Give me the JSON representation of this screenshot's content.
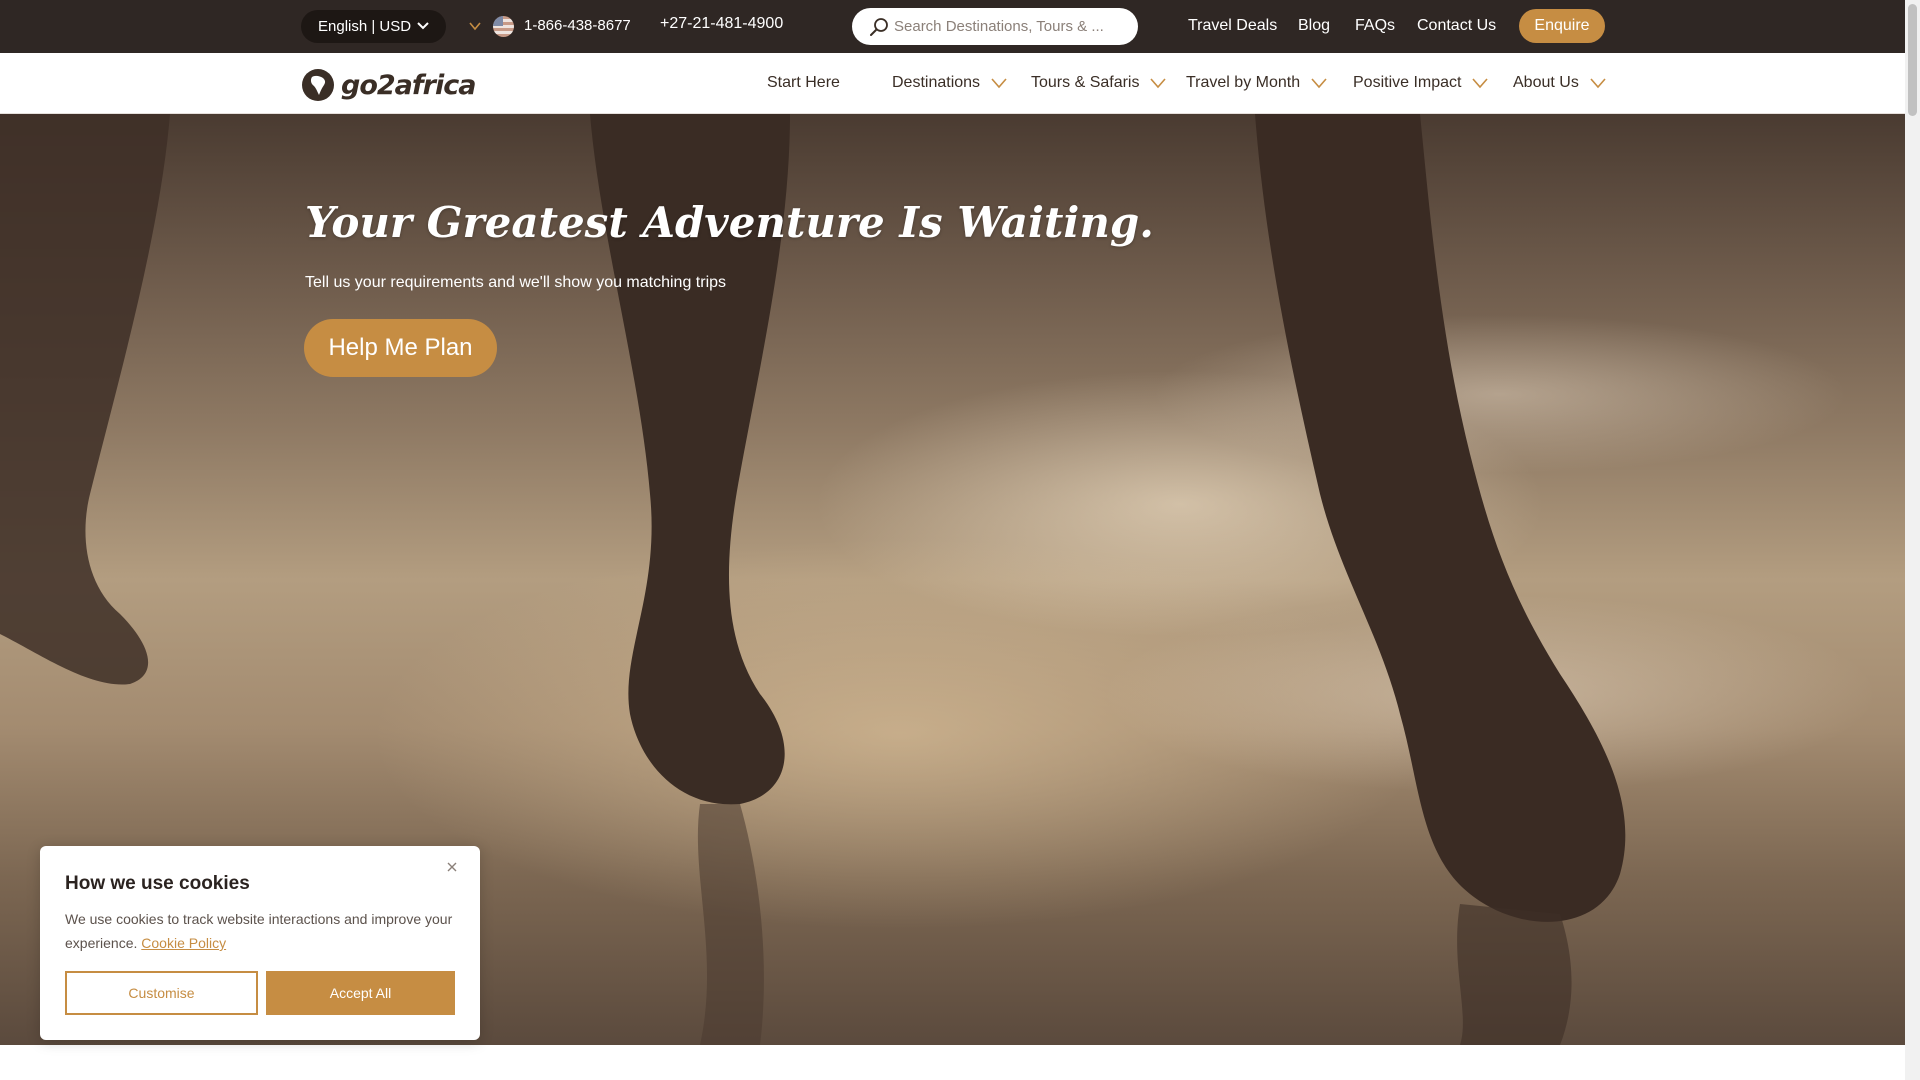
{
  "topbar": {
    "language_currency": "English | USD",
    "phone_primary": "1-866-438-8677",
    "phone_secondary": "+27-21-481-4900",
    "search_placeholder": "Search Destinations, Tours & ...",
    "links": [
      "Travel Deals",
      "Blog",
      "FAQs",
      "Contact Us"
    ],
    "enquire_label": "Enquire",
    "flag_icon": "us-flag-icon"
  },
  "nav": {
    "logo_text": "go2africa",
    "items": [
      "Start Here",
      "Destinations",
      "Tours & Safaris",
      "Travel by Month",
      "Positive Impact",
      "About Us"
    ]
  },
  "hero": {
    "title": "Your Greatest Adventure Is Waiting.",
    "subtitle": "Tell us your requirements and we'll show you matching trips",
    "cta_label": "Help Me Plan"
  },
  "cookie": {
    "title": "How we use cookies",
    "text": "We use cookies to track website interactions and improve your experience.",
    "policy_link": "Cookie Policy",
    "customise_label": "Customise",
    "accept_label": "Accept All"
  },
  "colors": {
    "accent": "#c68d43",
    "topbar_bg": "#2f2724",
    "text_dark": "#3a2e26"
  }
}
